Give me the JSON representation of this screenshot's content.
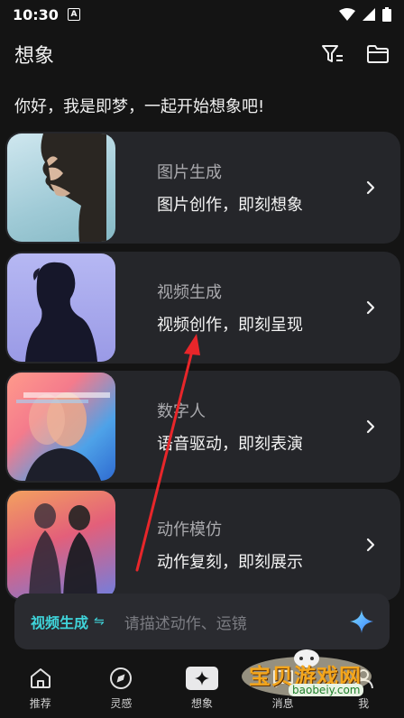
{
  "status": {
    "time": "10:30",
    "notif_letter": "A"
  },
  "header": {
    "title": "想象"
  },
  "greeting": "你好，我是即梦，一起开始想象吧!",
  "cards": [
    {
      "title": "图片生成",
      "subtitle": "图片创作，即刻想象"
    },
    {
      "title": "视频生成",
      "subtitle": "视频创作，即刻呈现"
    },
    {
      "title": "数字人",
      "subtitle": "语音驱动，即刻表演"
    },
    {
      "title": "动作模仿",
      "subtitle": "动作复刻，即刻展示"
    }
  ],
  "input": {
    "mode_label": "视频生成",
    "placeholder": "请描述动作、运镜"
  },
  "tabs": [
    {
      "label": "推荐"
    },
    {
      "label": "灵感"
    },
    {
      "label": "想象"
    },
    {
      "label": "消息"
    },
    {
      "label": "我"
    }
  ],
  "watermark": {
    "text": "宝贝游戏网",
    "url": "baobeiy.com"
  },
  "colors": {
    "accent": "#3fd3d9",
    "background": "#141414",
    "card": "#25262a"
  }
}
